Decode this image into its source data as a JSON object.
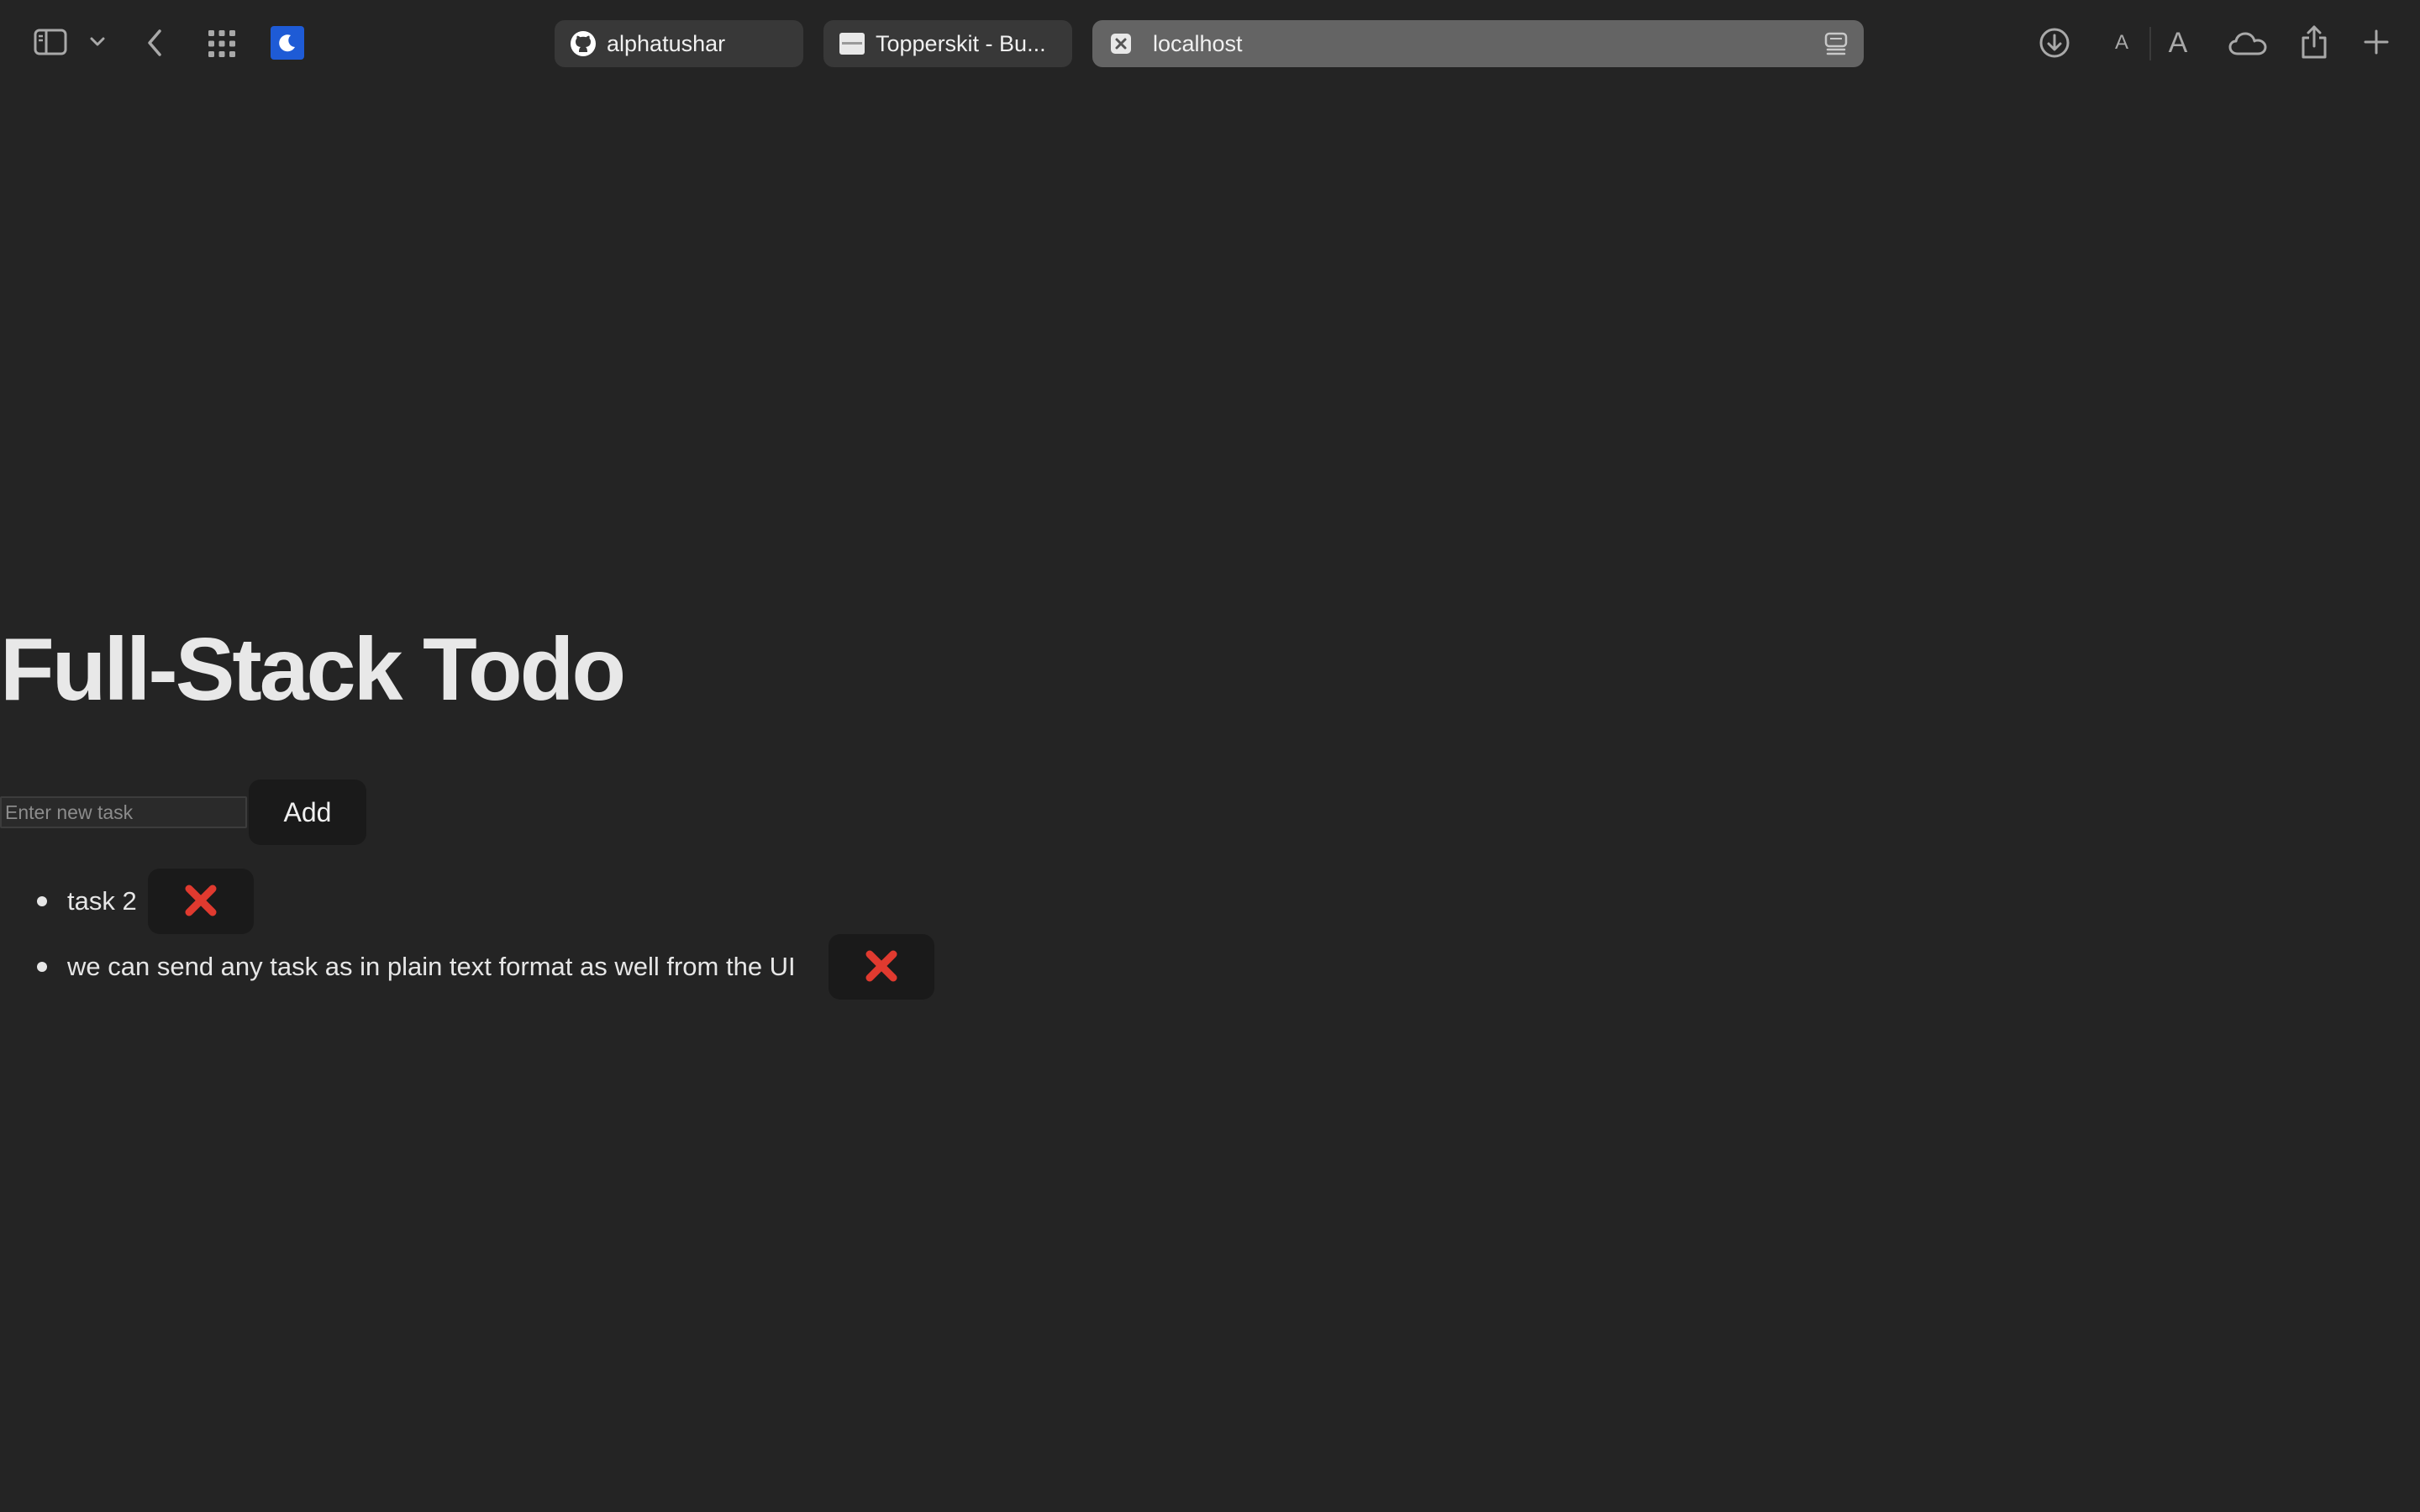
{
  "browser": {
    "tabs": [
      {
        "label": "alphatushar",
        "icon": "github-icon",
        "active": false
      },
      {
        "label": "Topperskit - Bu...",
        "icon": "site-favicon",
        "active": false
      },
      {
        "label": "localhost",
        "icon": "close-icon",
        "active": true
      }
    ],
    "toolbar_icons": [
      "sidebar-icon",
      "chevron-down-icon",
      "back-icon",
      "tab-overview-icon",
      "dark-mode-extension-icon",
      "download-icon",
      "text-smaller-icon",
      "text-larger-icon",
      "icloud-icon",
      "share-icon",
      "new-tab-icon"
    ],
    "text_small_label": "A",
    "text_large_label": "A"
  },
  "app": {
    "title": "Full-Stack Todo",
    "input": {
      "placeholder": "Enter new task",
      "value": ""
    },
    "add_label": "Add",
    "todos": [
      {
        "text": "task 2",
        "delete_icon": "❌"
      },
      {
        "text": "we can send any task as in plain text format as well from the UI",
        "delete_icon": "❌"
      }
    ]
  },
  "colors": {
    "background": "#242424",
    "button_bg": "#1a1a1a",
    "delete_red": "#e03a2f",
    "active_tab": "#646464",
    "inactive_tab": "#383838"
  }
}
